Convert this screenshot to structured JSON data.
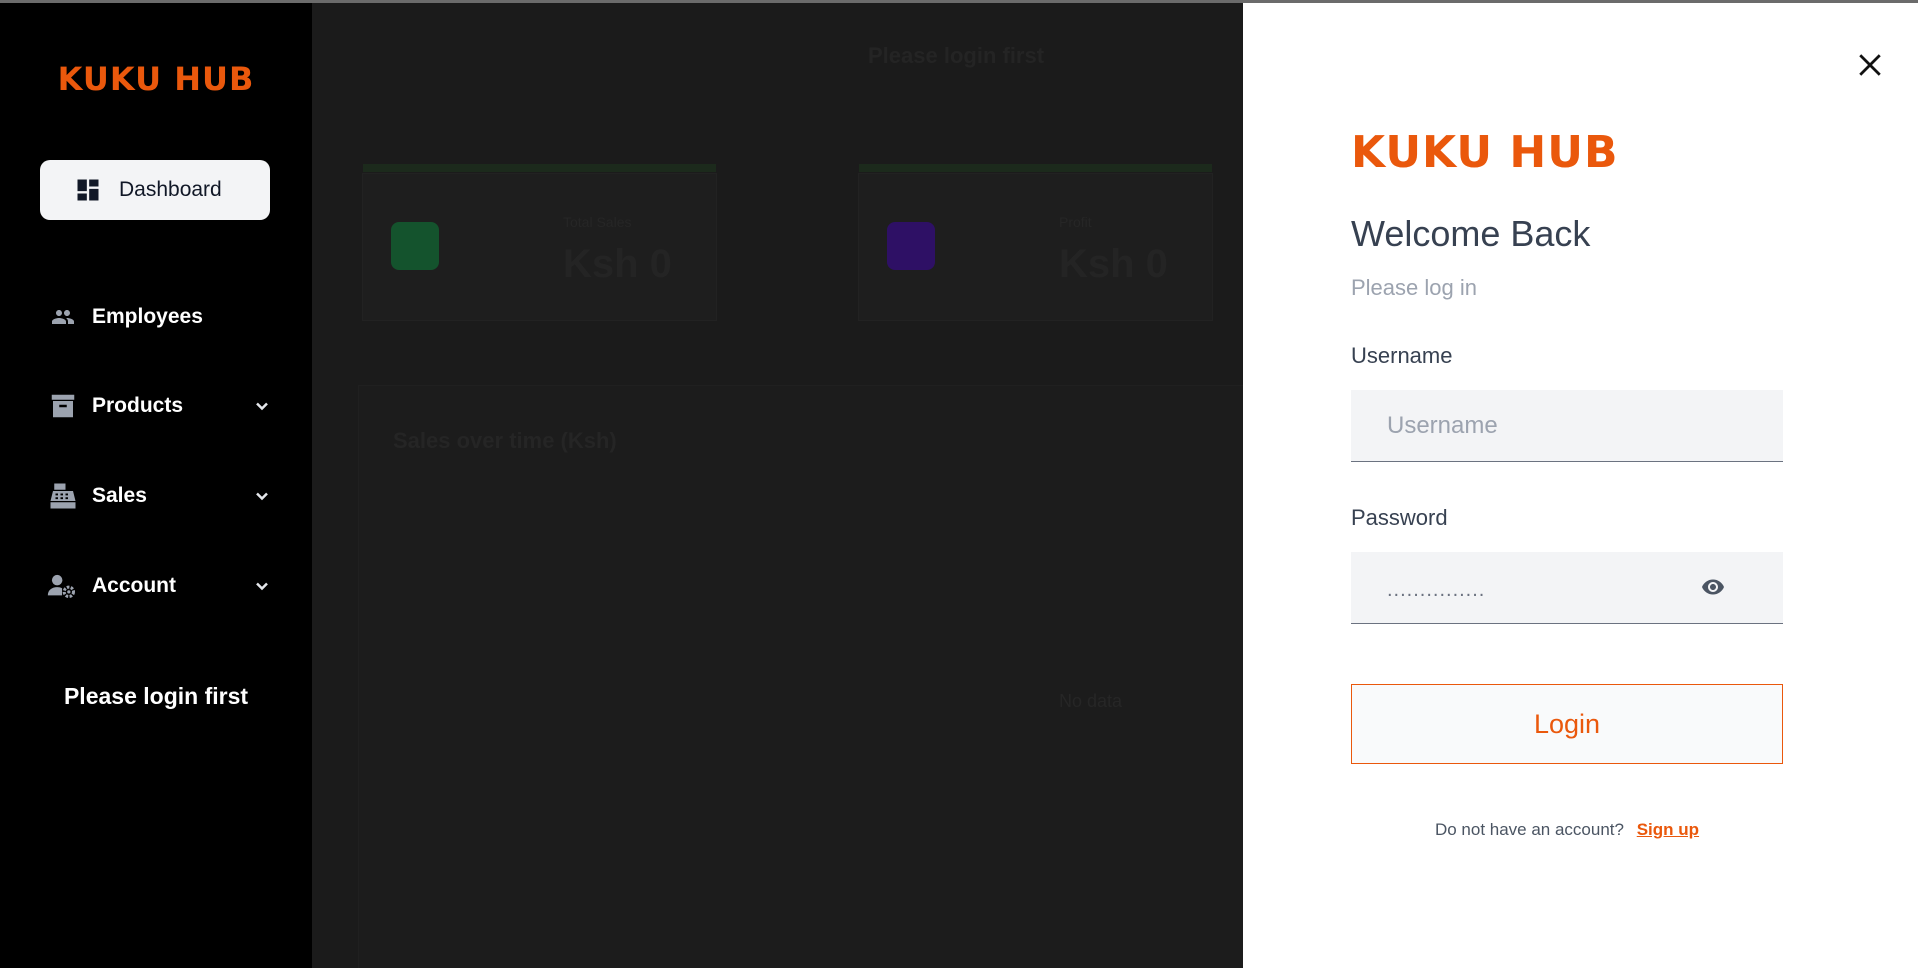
{
  "brand": {
    "name": "KUKU HUB",
    "accent": "#ea580c"
  },
  "sidebar": {
    "dashboard_label": "Dashboard",
    "items": [
      {
        "label": "Employees",
        "icon": "people-icon",
        "has_submenu": false
      },
      {
        "label": "Products",
        "icon": "archive-box-icon",
        "has_submenu": true
      },
      {
        "label": "Sales",
        "icon": "cash-register-icon",
        "has_submenu": true
      },
      {
        "label": "Account",
        "icon": "user-gear-icon",
        "has_submenu": true
      }
    ],
    "status_text": "Please login first"
  },
  "background": {
    "title": "Please login first",
    "cards": [
      {
        "label": "Total Sales",
        "value": "Ksh 0",
        "color": "#14532d"
      },
      {
        "label": "Profit",
        "value": "Ksh 0",
        "color": "#2e1065"
      }
    ],
    "panel_title": "Sales over time (Ksh)",
    "panel_note": "No data"
  },
  "login": {
    "title": "Welcome Back",
    "subtitle": "Please log in",
    "username_label": "Username",
    "username_placeholder": "Username",
    "password_label": "Password",
    "password_masked": "...............",
    "submit_label": "Login",
    "signup_prompt": "Do not have an account?",
    "signup_link": "Sign up"
  }
}
